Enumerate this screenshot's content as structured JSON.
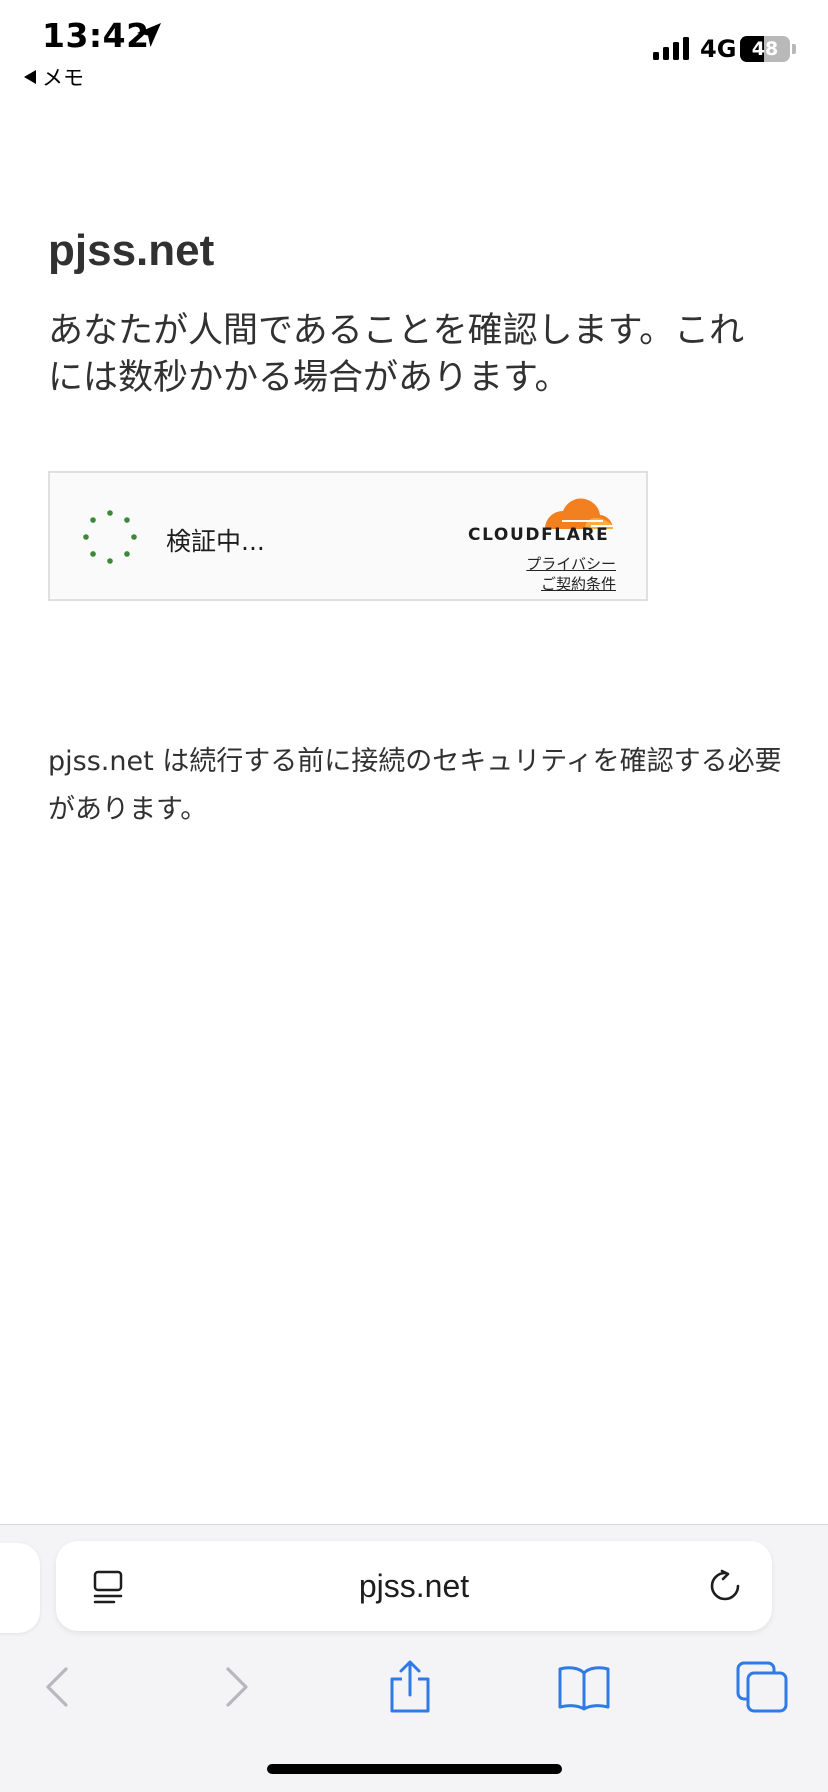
{
  "status_bar": {
    "time": "13:42",
    "back_app": "メモ",
    "network": "4G",
    "battery_level": "48",
    "battery_fraction": 0.48
  },
  "page": {
    "site_title": "pjss.net",
    "headline": "あなたが人間であることを確認します。これには数秒かかる場合があります。",
    "notice": "pjss.net は続行する前に接続のセキュリティを確認する必要があります。"
  },
  "challenge": {
    "status": "検証中...",
    "brand": "CLOUDFLARE",
    "privacy_link": "プライバシー",
    "terms_link": "ご契約条件",
    "spinner_color": "#3a8a3a",
    "brand_color": "#f38020"
  },
  "browser": {
    "address": "pjss.net",
    "accent_color": "#2f7ae5"
  },
  "icons": {
    "location": "location-arrow-icon",
    "signal": "cellular-signal-icon",
    "reader": "page-menu-icon",
    "reload": "reload-icon",
    "back": "chevron-left-icon",
    "forward": "chevron-right-icon",
    "share": "share-icon",
    "bookmarks": "book-icon",
    "tabs": "tabs-icon"
  }
}
